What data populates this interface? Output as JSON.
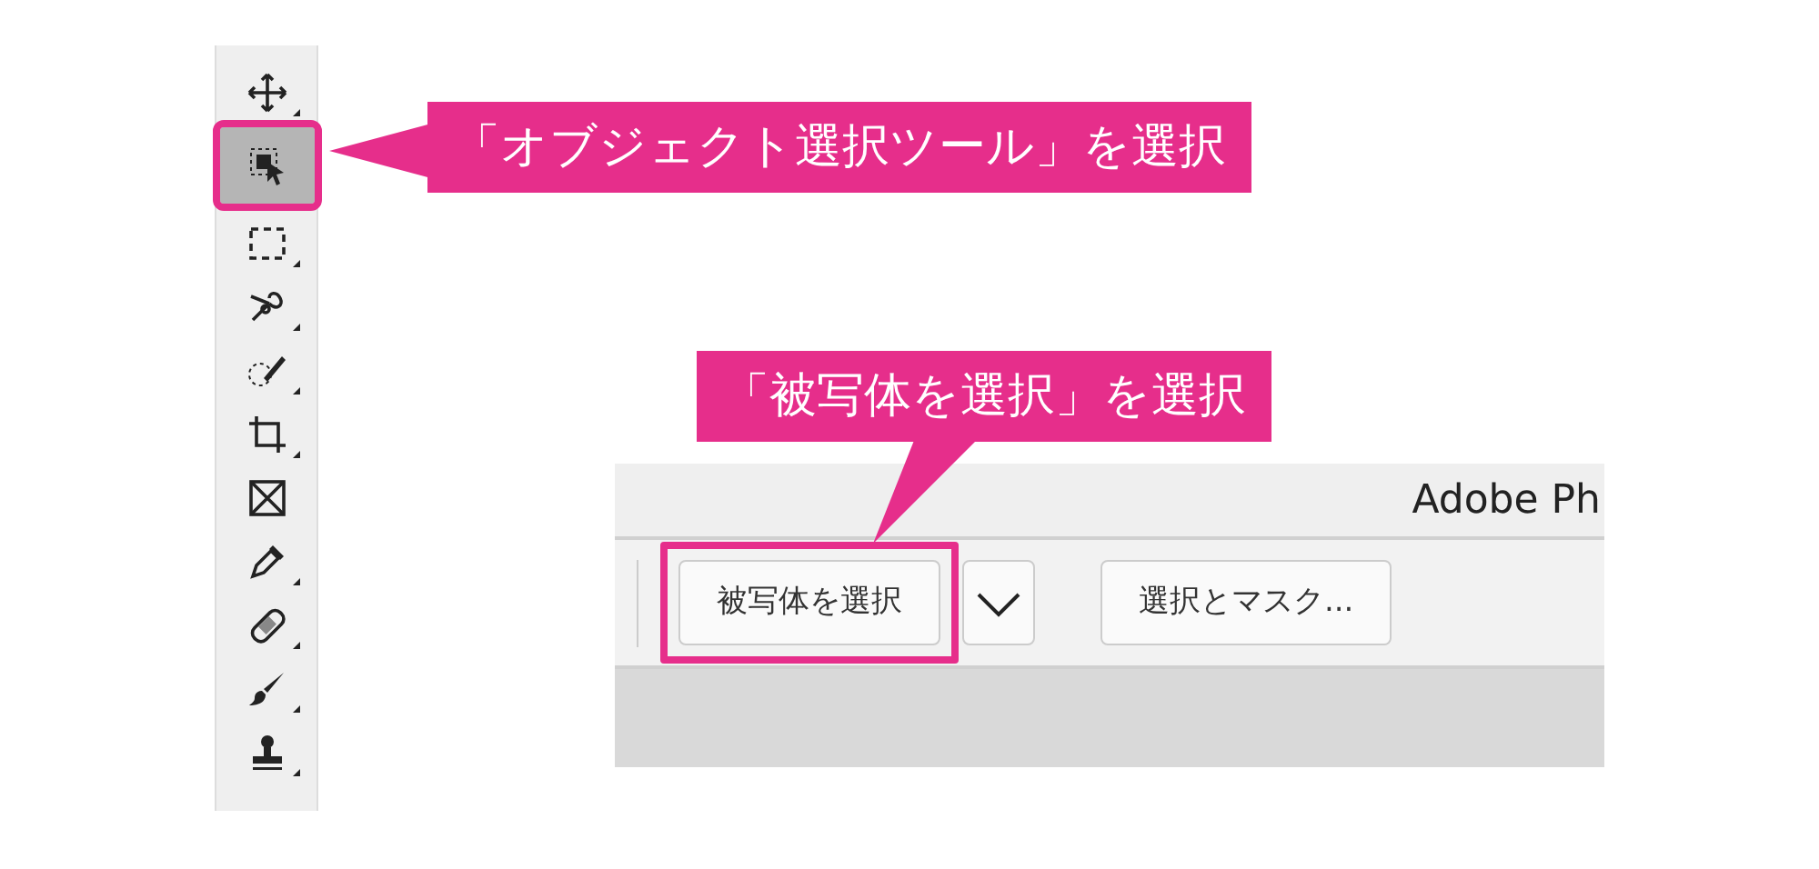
{
  "toolbar": {
    "tools": [
      {
        "kind": "move",
        "selected": false
      },
      {
        "kind": "object-select",
        "selected": true
      },
      {
        "kind": "marquee",
        "selected": false
      },
      {
        "kind": "lasso",
        "selected": false
      },
      {
        "kind": "quick-select",
        "selected": false
      },
      {
        "kind": "crop",
        "selected": false
      },
      {
        "kind": "frame",
        "selected": false
      },
      {
        "kind": "eyedropper",
        "selected": false
      },
      {
        "kind": "healing",
        "selected": false
      },
      {
        "kind": "brush",
        "selected": false
      },
      {
        "kind": "stamp",
        "selected": false
      }
    ]
  },
  "callouts": [
    {
      "text": "「オブジェクト選択ツール」を選択",
      "kind": "left-pointer"
    },
    {
      "text": "「被写体を選択」を選択",
      "kind": "down-pointer"
    }
  ],
  "window": {
    "title": "Adobe Ph",
    "buttons": [
      {
        "label": "被写体を選択",
        "highlighted": true,
        "has_menu": true
      },
      {
        "label": "選択とマスク...",
        "highlighted": false
      }
    ]
  }
}
